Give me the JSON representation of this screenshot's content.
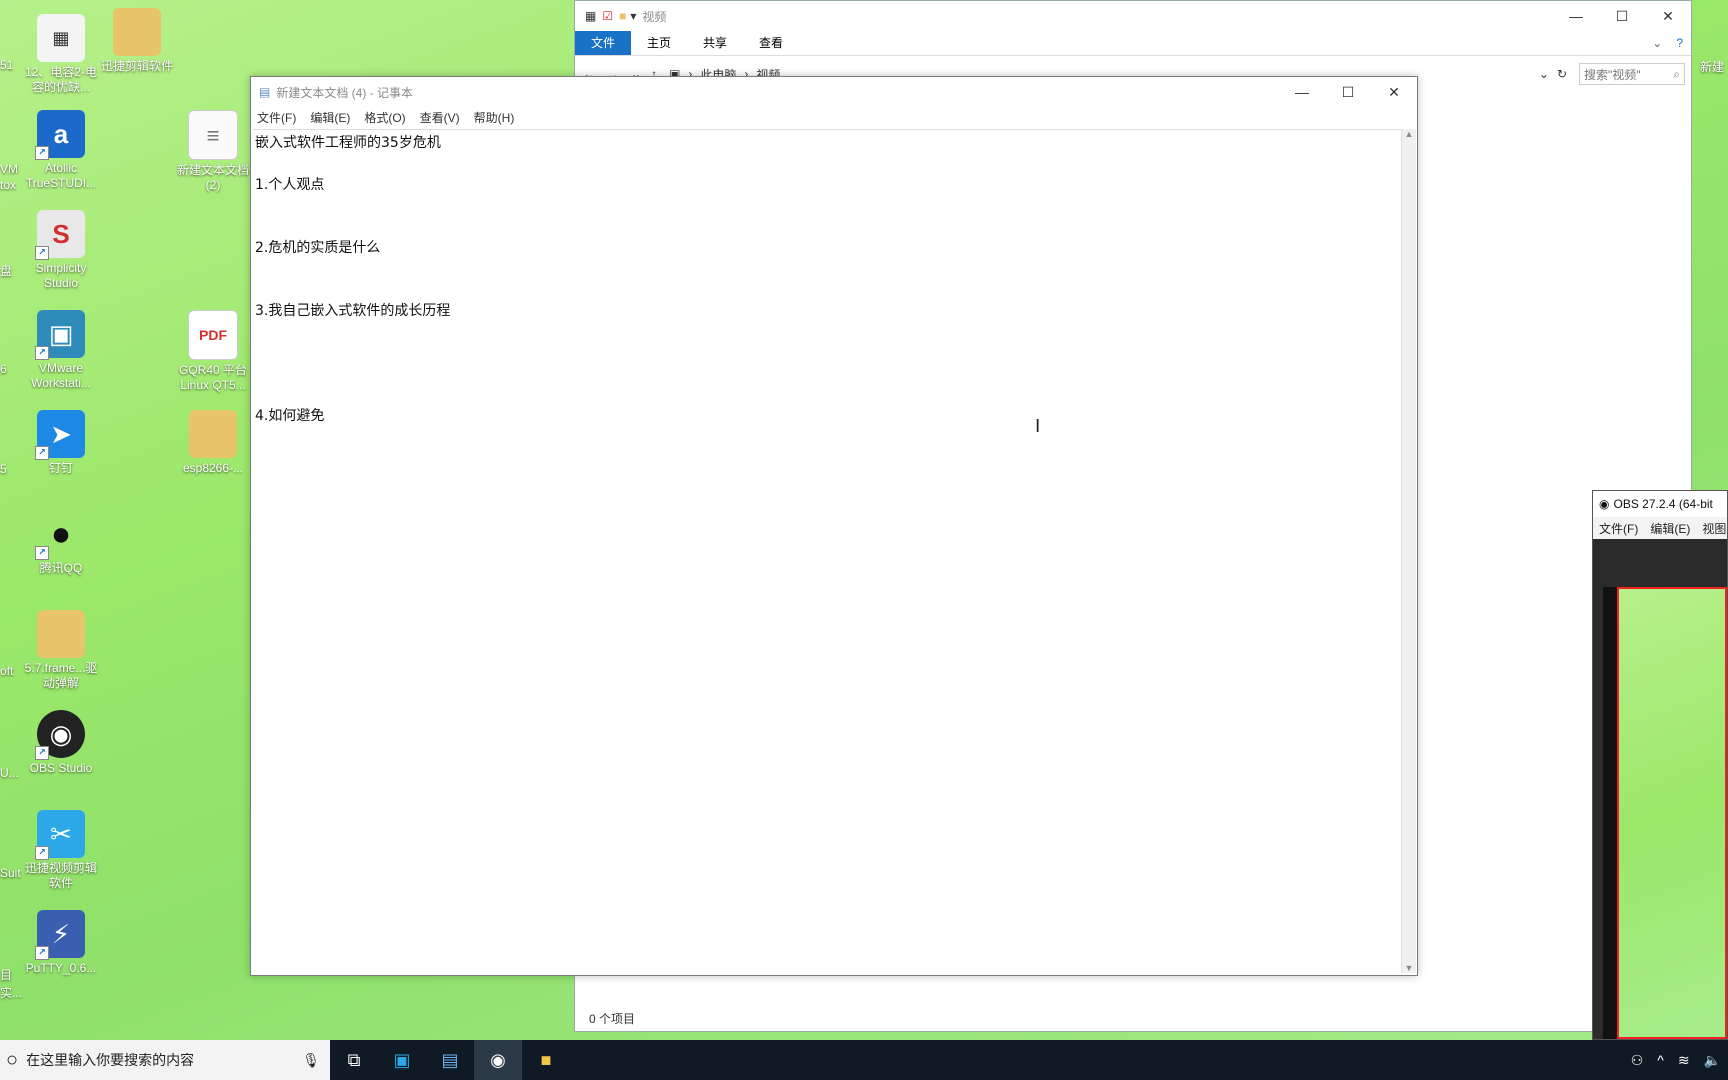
{
  "desktop": {
    "icons": [
      {
        "label": "12、电容2-电容的优缺...",
        "color": "#f4f4f4"
      },
      {
        "label": "迅捷剪辑软件",
        "color": "#e8c56a"
      },
      {
        "label": "Atollic TrueSTUDI...",
        "color": "#1b6ac9"
      },
      {
        "label": "新建文本文档 (2)",
        "color": "#ffffff"
      },
      {
        "label": "Simplicity Studio",
        "color": "#e8e8e8"
      },
      {
        "label": "VMware Workstati...",
        "color": "#2f8cba"
      },
      {
        "label": "GQR40 平台 Linux QT5...",
        "color": "#d32f2f"
      },
      {
        "label": "钉钉",
        "color": "#1e88e5"
      },
      {
        "label": "esp8266-...",
        "color": "#e8c56a"
      },
      {
        "label": "腾讯QQ",
        "color": "#111111"
      },
      {
        "label": "5.7.frame...驱动弹解",
        "color": "#e8c56a"
      },
      {
        "label": "OBS Studio",
        "color": "#222222"
      },
      {
        "label": "迅捷视频剪辑软件",
        "color": "#2aa8e8"
      },
      {
        "label": "PuTTY_0.6...",
        "color": "#3a5fb0"
      }
    ],
    "partial_left": [
      "51",
      "VM",
      "tox",
      "盘",
      "6",
      "5",
      "oft",
      "U...",
      "Suit",
      "目",
      "实..."
    ],
    "partial_right": "新建"
  },
  "explorer": {
    "title": "视频",
    "tabs": [
      "文件",
      "主页",
      "共享",
      "查看"
    ],
    "path": [
      "此电脑",
      "视频"
    ],
    "search_placeholder": "搜索\"视频\"",
    "status": "0 个项目"
  },
  "notepad": {
    "title": "新建文本文档 (4) - 记事本",
    "menu": [
      "文件(F)",
      "编辑(E)",
      "格式(O)",
      "查看(V)",
      "帮助(H)"
    ],
    "lines": [
      "嵌入式软件工程师的35岁危机",
      "1.个人观点",
      "2.危机的实质是什么",
      "3.我自己嵌入式软件的成长历程",
      "4.如何避免"
    ]
  },
  "obs": {
    "title": "OBS 27.2.4 (64-bit",
    "menu": [
      "文件(F)",
      "编辑(E)",
      "视图"
    ]
  },
  "taskbar": {
    "search_placeholder": "在这里输入你要搜索的内容"
  }
}
